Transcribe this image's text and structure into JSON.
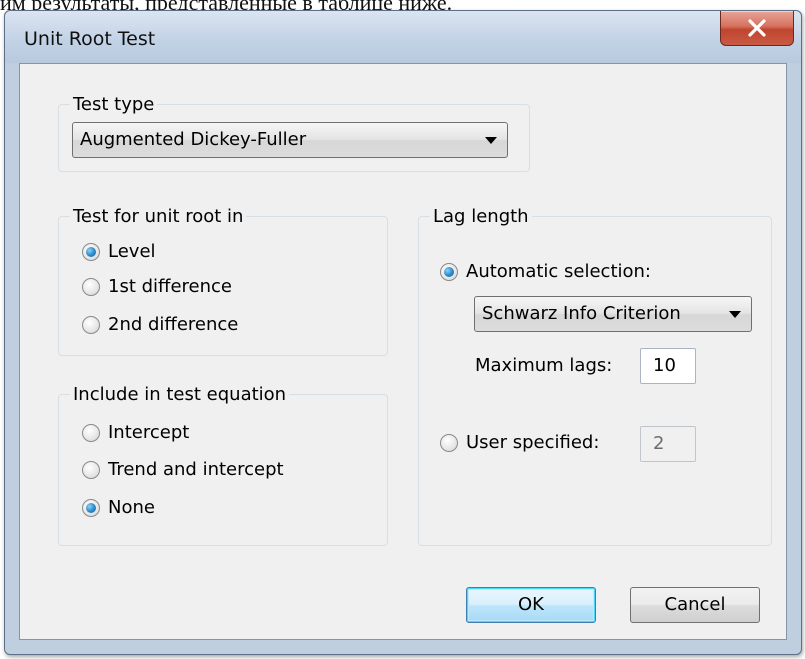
{
  "background": {
    "text": "им результаты, представленные в таблице ниже."
  },
  "window": {
    "title": "Unit Root Test",
    "close_icon": "close-icon"
  },
  "test_type": {
    "legend": "Test type",
    "selected": "Augmented Dickey-Fuller"
  },
  "unit_root_in": {
    "legend": "Test for unit root in",
    "options": [
      {
        "label": "Level",
        "checked": true
      },
      {
        "label": "1st difference",
        "checked": false
      },
      {
        "label": "2nd difference",
        "checked": false
      }
    ]
  },
  "test_equation": {
    "legend": "Include in test equation",
    "options": [
      {
        "label": "Intercept",
        "checked": false
      },
      {
        "label": "Trend and intercept",
        "checked": false
      },
      {
        "label": "None",
        "checked": true
      }
    ]
  },
  "lag_length": {
    "legend": "Lag length",
    "automatic_label": "Automatic selection:",
    "automatic_checked": true,
    "criterion_selected": "Schwarz Info Criterion",
    "max_lags_label": "Maximum lags:",
    "max_lags_value": "10",
    "user_label": "User specified:",
    "user_checked": false,
    "user_value": "2"
  },
  "buttons": {
    "ok": "OK",
    "cancel": "Cancel"
  },
  "colors": {
    "radio_accent": "#2a86c8",
    "close_button": "#c0452f",
    "dialog_face": "#f0f0f0"
  }
}
